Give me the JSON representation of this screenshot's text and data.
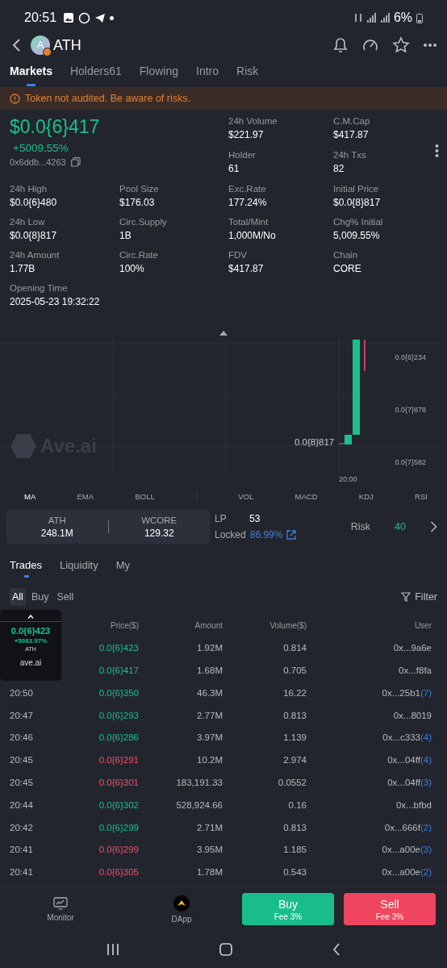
{
  "status_bar": {
    "time": "20:51",
    "battery": "6%"
  },
  "header": {
    "avatar_letter": "A",
    "title": "ATH"
  },
  "tabs": [
    {
      "label": "Markets",
      "selected": true
    },
    {
      "label": "Holders61",
      "selected": false
    },
    {
      "label": "Flowing",
      "selected": false
    },
    {
      "label": "Intro",
      "selected": false
    },
    {
      "label": "Risk",
      "selected": false
    }
  ],
  "warning": "Token not audited. Be aware of risks.",
  "price": {
    "value": "$0.0{6}417",
    "change": "+5009.55%",
    "address": "0x6ddb...4263"
  },
  "top_stats": [
    {
      "label": "24h Volume",
      "value": "$221.97"
    },
    {
      "label": "C.M.Cap",
      "value": "$417.87"
    },
    {
      "label": "Holder",
      "value": "61"
    },
    {
      "label": "24h Txs",
      "value": "82"
    }
  ],
  "stats": [
    {
      "label": "24h High",
      "value": "$0.0{6}480"
    },
    {
      "label": "Pool Size",
      "value": "$176.03"
    },
    {
      "label": "Exc.Rate",
      "value": "177.24%"
    },
    {
      "label": "Initial Price",
      "value": "$0.0{8}817"
    },
    {
      "label": "24h Low",
      "value": "$0.0{8}817"
    },
    {
      "label": "Circ.Supply",
      "value": "1B"
    },
    {
      "label": "Total/Mint",
      "value": "1,000M/No"
    },
    {
      "label": "Chg% Initial",
      "value": "5,009.55%"
    },
    {
      "label": "24h Amount",
      "value": "1.77B"
    },
    {
      "label": "Circ.Rate",
      "value": "100%"
    },
    {
      "label": "FDV",
      "value": "$417.87"
    },
    {
      "label": "Chain",
      "value": "CORE"
    }
  ],
  "opening_time": {
    "label": "Opening Time",
    "value": "2025-05-23 19:32:22"
  },
  "chart": {
    "watermark": "Ave.ai",
    "y_labels": [
      "0.0{6}234",
      "0.0{7}878",
      "0.0{7}582"
    ],
    "x_label": "20:00",
    "marker": "0.0{8}817"
  },
  "indicators": [
    {
      "label": "MA",
      "selected": true
    },
    {
      "label": "EMA",
      "selected": false
    },
    {
      "label": "BOLL",
      "selected": false
    },
    {
      "label": "VOL",
      "selected": false
    },
    {
      "label": "MACD",
      "selected": false
    },
    {
      "label": "KDJ",
      "selected": false
    },
    {
      "label": "RSI",
      "selected": false
    }
  ],
  "pool": {
    "pair": [
      {
        "symbol": "ATH",
        "amount": "248.1M"
      },
      {
        "symbol": "WCORE",
        "amount": "129.32"
      }
    ],
    "lp": {
      "label": "LP",
      "value": "53"
    },
    "locked": {
      "label": "Locked",
      "value": "86.99%"
    },
    "risk": {
      "label": "Risk",
      "value": "40"
    }
  },
  "trade_tabs": [
    {
      "label": "Trades",
      "selected": true
    },
    {
      "label": "Liquidity",
      "selected": false
    },
    {
      "label": "My",
      "selected": false
    }
  ],
  "filters": [
    {
      "label": "All",
      "selected": true
    },
    {
      "label": "Buy",
      "selected": false
    },
    {
      "label": "Sell",
      "selected": false
    }
  ],
  "filter_button": "Filter",
  "table": {
    "columns": [
      "Price($)",
      "Amount",
      "Volume($)",
      "User"
    ],
    "rows": [
      {
        "price": "0.0{6}423",
        "color": "#19c08b",
        "amount": "1.92M",
        "volume": "0.814",
        "user": "0x...9a6e"
      },
      {
        "price": "0.0{6}417",
        "color": "#19c08b",
        "amount": "1.68M",
        "volume": "0.705",
        "user": "0x...f8fa"
      },
      {
        "time": "20:50",
        "price": "0.0{6}350",
        "color": "#19c08b",
        "amount": "46.3M",
        "volume": "16.22",
        "user": "0x...25b1",
        "count": "(7)"
      },
      {
        "time": "20:47",
        "price": "0.0{6}293",
        "color": "#19c08b",
        "amount": "2.77M",
        "volume": "0.813",
        "user": "0x...8019"
      },
      {
        "time": "20:46",
        "price": "0.0{6}286",
        "color": "#19c08b",
        "amount": "3.97M",
        "volume": "1.139",
        "user": "0x...c333",
        "count": "(4)"
      },
      {
        "time": "20:45",
        "price": "0.0{6}291",
        "color": "#f0506e",
        "amount": "10.2M",
        "volume": "2.974",
        "user": "0x...04ff",
        "count": "(4)"
      },
      {
        "time": "20:45",
        "price": "0.0{6}301",
        "color": "#f0506e",
        "amount": "183,191.33",
        "volume": "0.0552",
        "user": "0x...04ff",
        "count": "(3)"
      },
      {
        "time": "20:44",
        "price": "0.0{6}302",
        "color": "#19c08b",
        "amount": "528,924.66",
        "volume": "0.16",
        "user": "0x...bfbd"
      },
      {
        "time": "20:42",
        "price": "0.0{6}299",
        "color": "#19c08b",
        "amount": "2.71M",
        "volume": "0.813",
        "user": "0x...666f",
        "count": "(2)"
      },
      {
        "time": "20:41",
        "price": "0.0{6}299",
        "color": "#f0506e",
        "amount": "3.95M",
        "volume": "1.185",
        "user": "0x...a00e",
        "count": "(3)"
      },
      {
        "time": "20:41",
        "price": "0.0{6}305",
        "color": "#f0506e",
        "amount": "1.78M",
        "volume": "0.543",
        "user": "0x...a00e",
        "count": "(2)"
      }
    ]
  },
  "floating_widget": {
    "price": "0.0{6}423",
    "change": "+5083.97%",
    "symbol": "ATH",
    "brand": "ave.ai"
  },
  "bottom_bar": {
    "monitor": "Monitor",
    "dapp": "DApp",
    "buy": {
      "label": "Buy",
      "fee": "Fee 3%"
    },
    "sell": {
      "label": "Sell",
      "fee": "Fee 3%"
    }
  }
}
